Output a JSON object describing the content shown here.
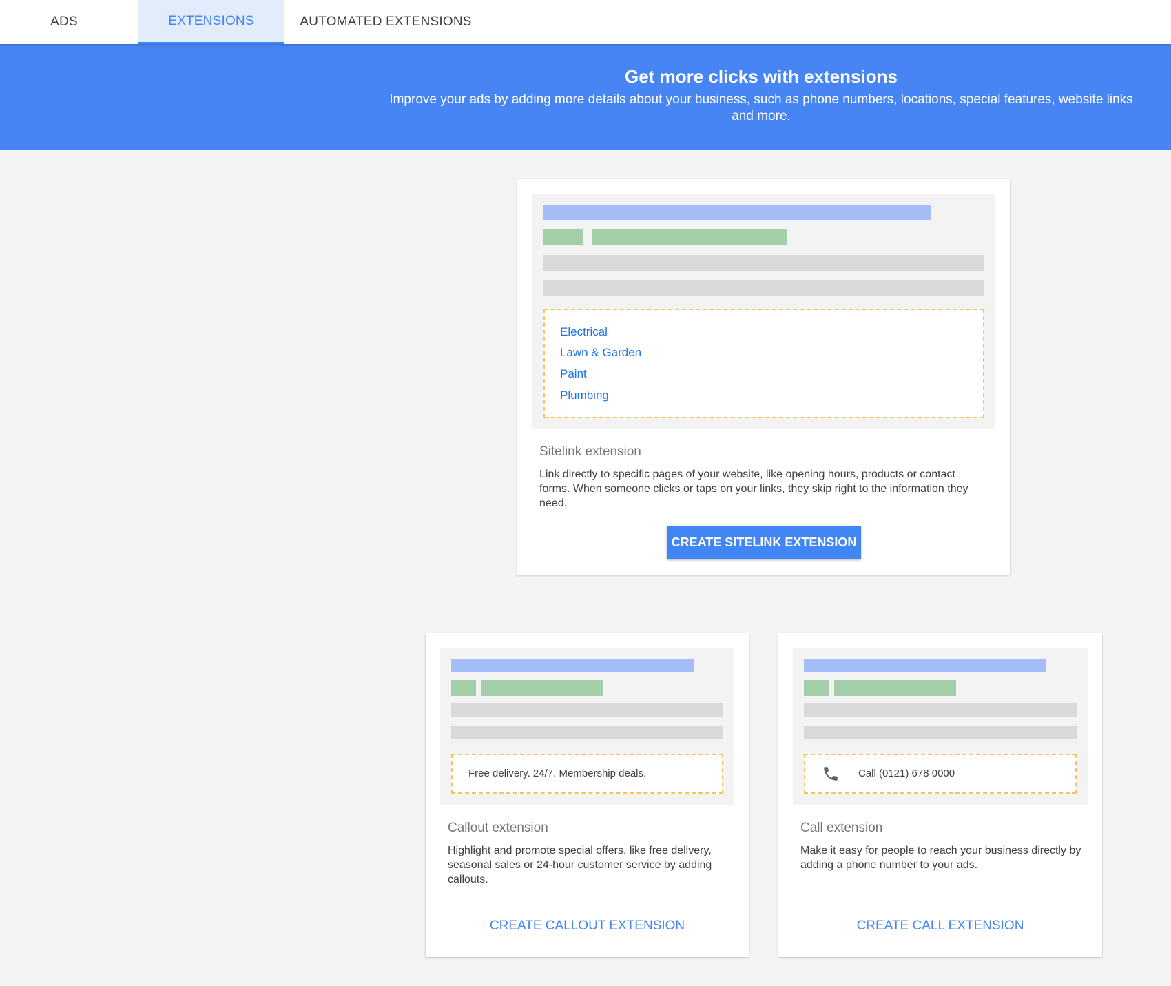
{
  "tabs": [
    {
      "label": "ADS",
      "active": false
    },
    {
      "label": "EXTENSIONS",
      "active": true
    },
    {
      "label": "AUTOMATED EXTENSIONS",
      "active": false
    }
  ],
  "hero": {
    "title": "Get more clicks with extensions",
    "subtitle": "Improve your ads by adding more details about your business, such as phone numbers, locations, special features, website links and more."
  },
  "sitelink_card": {
    "links": [
      "Electrical",
      "Lawn & Garden",
      "Paint",
      "Plumbing"
    ],
    "title": "Sitelink extension",
    "description": "Link directly to specific pages of your website, like opening hours, products or contact forms. When someone clicks or taps on your links, they skip right to the information they need.",
    "button": "CREATE SITELINK EXTENSION"
  },
  "callout_card": {
    "preview_text": "Free delivery. 24/7. Membership deals.",
    "title": "Callout extension",
    "description": "Highlight and promote special offers, like free delivery, seasonal sales or 24-hour customer service by adding callouts.",
    "button": "CREATE CALLOUT EXTENSION"
  },
  "call_card": {
    "preview_icon": "phone-icon",
    "preview_text": "Call (0121) 678 0000",
    "title": "Call extension",
    "description": "Make it easy for people to reach your business directly by adding a phone number to your ads.",
    "button": "CREATE CALL EXTENSION"
  },
  "colors": {
    "accent": "#4285f4",
    "hero_bg": "#4885f4",
    "dashed_border": "#fbc15c"
  }
}
